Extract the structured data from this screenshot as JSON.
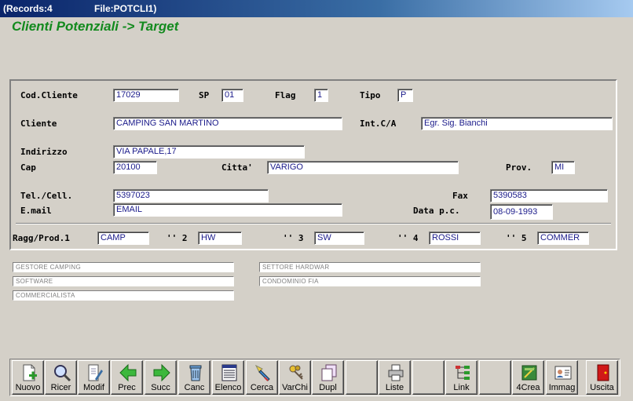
{
  "titlebar": {
    "records": "(Records:4",
    "file": "File:POTCLI1)"
  },
  "app_title": "Clienti Potenziali -> Target",
  "labels": {
    "cod_cliente": "Cod.Cliente",
    "sp": "SP",
    "flag": "Flag",
    "tipo": "Tipo",
    "cliente": "Cliente",
    "int_ca": "Int.C/A",
    "indirizzo": "Indirizzo",
    "cap": "Cap",
    "citta": "Citta'",
    "prov": "Prov.",
    "tel": "Tel./Cell.",
    "fax": "Fax",
    "email": "E.mail",
    "data_pc": "Data p.c.",
    "ragg1": "Ragg/Prod.1",
    "ragg2": "'' 2",
    "ragg3": "'' 3",
    "ragg4": "'' 4",
    "ragg5": "'' 5"
  },
  "fields": {
    "cod_cliente": "17029",
    "sp": "01",
    "flag": "1",
    "tipo": "P",
    "cliente": "CAMPING SAN MARTINO",
    "int_ca": "Egr. Sig. Bianchi",
    "indirizzo": "VIA PAPALE,17",
    "cap": "20100",
    "citta": "VARIGO",
    "prov": "MI",
    "tel": "5397023",
    "fax": "5390583",
    "email": "EMAIL",
    "data_pc": "08-09-1993",
    "ragg1": "CAMP",
    "ragg2": "HW",
    "ragg3": "SW",
    "ragg4": "ROSSI",
    "ragg5": "COMMER"
  },
  "descriptions": {
    "d1": "GESTORE CAMPING",
    "d2": "SETTORE HARDWAR",
    "d3": "SOFTWARE",
    "d4": "CONDOMINIO FIA",
    "d5": "COMMERCIALISTA"
  },
  "toolbar": {
    "nuovo": "Nuovo",
    "ricer": "Ricer",
    "modif": "Modif",
    "prec": "Prec",
    "succ": "Succ",
    "canc": "Canc",
    "elenco": "Elenco",
    "cerca": "Cerca",
    "varchi": "VarChi",
    "dupl": "Dupl",
    "liste": "Liste",
    "link": "Link",
    "crea4": "4Crea",
    "immag": "Immag",
    "uscita": "Uscita"
  },
  "colors": {
    "title_green": "#138a1e",
    "field_text": "#1a1a8a",
    "titlebar": "#0a246a"
  }
}
